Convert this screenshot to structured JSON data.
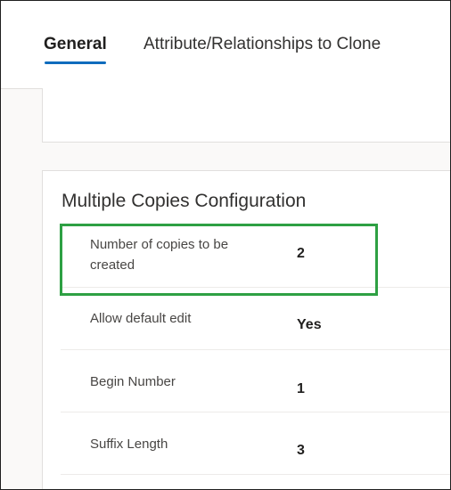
{
  "tabs": [
    {
      "label": "General",
      "selected": true
    },
    {
      "label": "Attribute/Relationships to Clone",
      "selected": false
    }
  ],
  "section": {
    "title": "Multiple Copies Configuration"
  },
  "fields": [
    {
      "label": "Number of copies to be created",
      "value": "2"
    },
    {
      "label": "Allow default edit",
      "value": "Yes"
    },
    {
      "label": "Begin Number",
      "value": "1"
    },
    {
      "label": "Suffix Length",
      "value": "3"
    }
  ],
  "colors": {
    "accent": "#0f6cbd",
    "highlight": "#2ea043"
  }
}
